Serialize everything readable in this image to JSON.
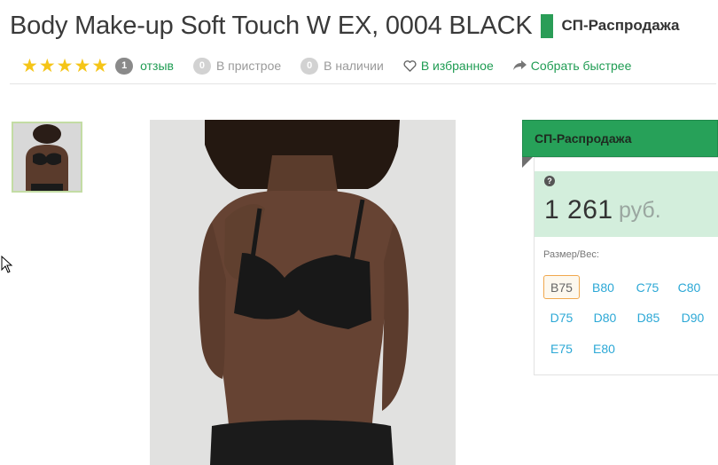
{
  "product": {
    "title": "Body Make-up Soft Touch W EX, 0004 BLACK",
    "badge_label": "СП-Распродажа"
  },
  "meta": {
    "rating": 5,
    "star_icon": "star-icon",
    "reviews_count": "1",
    "reviews_label": "отзыв",
    "in_progress_count": "0",
    "in_progress_label": "В пристрое",
    "in_stock_count": "0",
    "in_stock_label": "В наличии",
    "favorite_label": "В избранное",
    "favorite_icon": "heart-outline-icon",
    "collect_label": "Собрать быстрее",
    "collect_icon": "share-arrow-icon"
  },
  "gallery": {
    "thumbnail_alt": "product-thumbnail",
    "main_alt": "product-photo"
  },
  "panel": {
    "header": "СП-Распродажа",
    "help_symbol": "?",
    "price": "1 261",
    "currency": "руб.",
    "size_label": "Размер/Вес:",
    "sizes": [
      {
        "label": "B75",
        "selected": true
      },
      {
        "label": "B80",
        "selected": false
      },
      {
        "label": "C75",
        "selected": false
      },
      {
        "label": "C80",
        "selected": false
      },
      {
        "label": "D75",
        "selected": false
      },
      {
        "label": "D80",
        "selected": false
      },
      {
        "label": "D85",
        "selected": false
      },
      {
        "label": "D90",
        "selected": false
      },
      {
        "label": "E75",
        "selected": false
      },
      {
        "label": "E80",
        "selected": false
      }
    ]
  },
  "colors": {
    "accent_green": "#27a159",
    "link_green": "#1f9c53",
    "price_bg": "#d3eedc",
    "size_link": "#2ca8d6",
    "selected_border": "#f0a84d",
    "star": "#f5c518"
  }
}
